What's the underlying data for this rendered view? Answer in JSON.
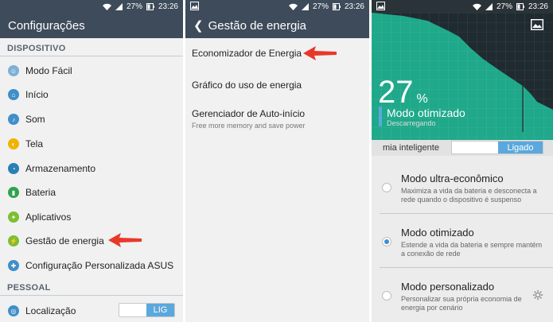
{
  "status": {
    "battery": "27%",
    "time": "23:26"
  },
  "settings": {
    "title": "Configurações",
    "section1": "DISPOSITIVO",
    "items": [
      {
        "label": "Modo Fácil",
        "color": "#7fb0d6"
      },
      {
        "label": "Início",
        "color": "#3f8fc9"
      },
      {
        "label": "Som",
        "color": "#3f8fc9"
      },
      {
        "label": "Tela",
        "color": "#f0b400"
      },
      {
        "label": "Armazenamento",
        "color": "#2a7fb5"
      },
      {
        "label": "Bateria",
        "color": "#2fa34a"
      },
      {
        "label": "Aplicativos",
        "color": "#7cbf32"
      },
      {
        "label": "Gestão de energia",
        "color": "#7cbf32"
      },
      {
        "label": "Configuração Personalizada ASUS",
        "color": "#3f8fc9"
      }
    ],
    "section2": "PESSOAL",
    "location": {
      "label": "Localização",
      "toggle": "LIG",
      "color": "#3f8fc9"
    }
  },
  "energy": {
    "title": "Gestão de energia",
    "items": [
      {
        "title": "Economizador de Energia",
        "subtitle": ""
      },
      {
        "title": "Gráfico do uso de energia",
        "subtitle": ""
      },
      {
        "title": "Gerenciador de Auto-início",
        "subtitle": "Free more memory and save power"
      }
    ]
  },
  "saver": {
    "percent": "27",
    "percent_sign": "%",
    "mode": "Modo otimizado",
    "state": "Descarregando",
    "smart_label": "mia inteligente",
    "smart_toggle": "Ligado",
    "options": [
      {
        "title": "Modo ultra-econômico",
        "desc": "Maximiza a vida da bateria e desconecta a rede quando o dispositivo é suspenso",
        "selected": false
      },
      {
        "title": "Modo otimizado",
        "desc": "Estende a vida da bateria e sempre mantém a conexão de rede",
        "selected": true
      },
      {
        "title": "Modo personalizado",
        "desc": "Personalizar sua própria economia de energia por cenário",
        "selected": false
      }
    ]
  },
  "colors": {
    "bar": "#3d4b5a",
    "accent": "#5aa8dd",
    "arrow": "#e8382a",
    "chart_fill": "#1fa88a"
  }
}
